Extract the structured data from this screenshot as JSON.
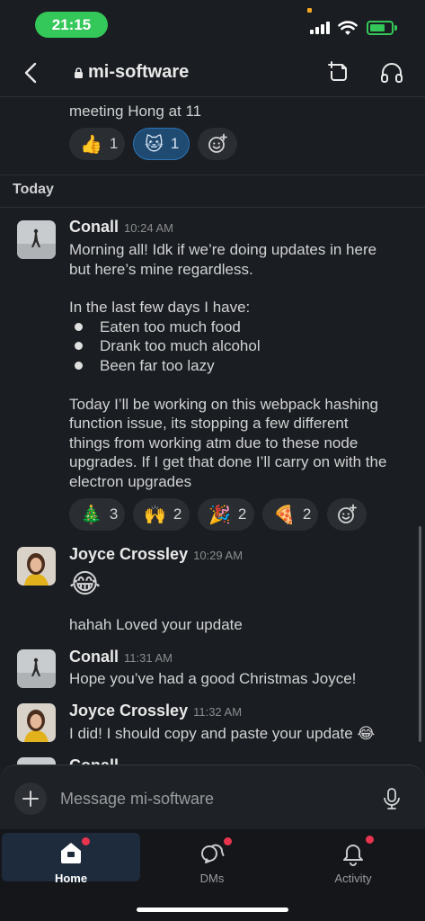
{
  "status_bar": {
    "time": "21:15"
  },
  "header": {
    "channel_name": "mi-software"
  },
  "messages": {
    "prev_tail": "meeting Hong at 11",
    "prev_reactions": [
      {
        "emoji": "👍",
        "count": "1"
      },
      {
        "emoji": "🐱",
        "count": "1"
      }
    ],
    "day_divider": "Today",
    "conall_1": {
      "name": "Conall",
      "time": "10:24 AM",
      "lines": [
        "Morning all! Idk if we’re doing updates in here",
        "but here’s mine regardless.",
        "In the last few days I have:"
      ],
      "bullets": [
        "Eaten too much food",
        "Drank too much alcohol",
        "Been far too lazy"
      ],
      "para": [
        "Today I’ll be working on this webpack hashing",
        "function issue, its stopping a few different",
        "things from working atm due to these node",
        "upgrades. If I get that done I’ll carry on with the",
        "electron upgrades"
      ],
      "reactions": [
        {
          "emoji": "🎄",
          "count": "3"
        },
        {
          "emoji": "🙌",
          "count": "2"
        },
        {
          "emoji": "🎉",
          "count": "2"
        },
        {
          "emoji": "🍕",
          "count": "2"
        }
      ]
    },
    "joyce_1": {
      "name": "Joyce Crossley",
      "time": "10:29 AM",
      "emoji": "😂",
      "text": "hahah Loved your update"
    },
    "conall_2": {
      "name": "Conall",
      "time": "11:31 AM",
      "text": "Hope you’ve had a good Christmas Joyce!"
    },
    "joyce_2": {
      "name": "Joyce Crossley",
      "time": "11:32 AM",
      "text": "I did! I should copy and paste your update 😂"
    },
    "partial_name": "Conall"
  },
  "composer": {
    "placeholder": "Message mi-software"
  },
  "tabs": [
    {
      "label": "Home",
      "icon": "home-icon"
    },
    {
      "label": "DMs",
      "icon": "dms-icon"
    },
    {
      "label": "Activity",
      "icon": "bell-icon"
    }
  ],
  "colors": {
    "accent_green": "#34c759",
    "notification_red": "#e8344e",
    "active_reaction": "#1f4a72"
  }
}
